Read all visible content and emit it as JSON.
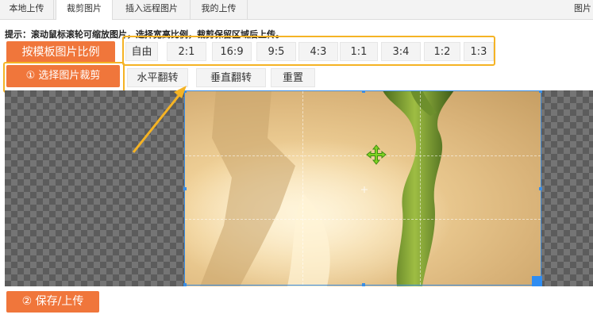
{
  "tabs": [
    {
      "label": "本地上传",
      "active": false
    },
    {
      "label": "裁剪图片",
      "active": true
    },
    {
      "label": "插入远程图片",
      "active": false
    },
    {
      "label": "我的上传",
      "active": false
    }
  ],
  "tab_right": "图片",
  "hint": "提示：滚动鼠标滚轮可缩放图片，选择宽高比例，裁剪保留区域后上传。",
  "template_ratio_button": "按模板图片比例",
  "select_crop_button": "① 选择图片裁剪",
  "ratios": [
    "自由",
    "2:1",
    "16:9",
    "9:5",
    "4:3",
    "1:1",
    "3:4",
    "1:2",
    "1:3"
  ],
  "tools": {
    "flip_horizontal": "水平翻转",
    "flip_vertical": "垂直翻转",
    "reset": "重置"
  },
  "save_upload_button": "② 保存/上传",
  "colors": {
    "accent_orange": "#f0763b",
    "highlight_yellow": "#f5b324",
    "crop_blue": "#3a8ee6"
  }
}
